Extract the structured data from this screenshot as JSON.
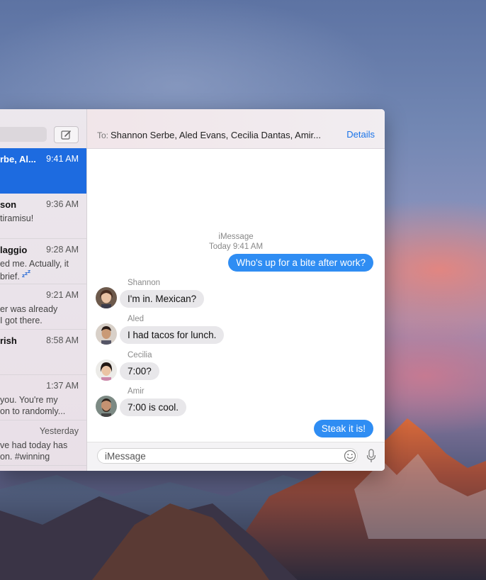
{
  "sidebar": {
    "conversations": [
      {
        "name": "rbe, Al...",
        "time": "9:41 AM",
        "preview": [],
        "active": true
      },
      {
        "name": "son",
        "time": "9:36 AM",
        "preview": [
          "tiramisu!"
        ]
      },
      {
        "name": "laggio",
        "time": "9:28 AM",
        "preview": [
          "ed me. Actually, it",
          "brief."
        ]
      },
      {
        "name": "",
        "time": "9:21 AM",
        "preview": [
          "er was already",
          "I got there."
        ]
      },
      {
        "name": "rish",
        "time": "8:58 AM",
        "preview": []
      },
      {
        "name": "",
        "time": "1:37 AM",
        "preview": [
          "you. You're my",
          "on to randomly..."
        ]
      },
      {
        "name": "",
        "time": "Yesterday",
        "preview": [
          "ve had today has",
          "on. #winning"
        ]
      }
    ]
  },
  "header": {
    "to_label": "To:",
    "recipients": "Shannon Serbe, Aled Evans, Cecilia Dantas, Amir...",
    "details_label": "Details"
  },
  "thread": {
    "service": "iMessage",
    "timestamp": "Today 9:41 AM",
    "messages": [
      {
        "from": "me",
        "text": "Who's up for a bite after work?"
      },
      {
        "from": "Shannon",
        "text": "I'm in. Mexican?"
      },
      {
        "from": "Aled",
        "text": "I had tacos for lunch."
      },
      {
        "from": "Cecilia",
        "text": "7:00?"
      },
      {
        "from": "Amir",
        "text": "7:00 is cool."
      },
      {
        "from": "me",
        "text": "Steak it is!"
      }
    ]
  },
  "composer": {
    "placeholder": "iMessage"
  },
  "colors": {
    "accent": "#1d6be0",
    "outgoing_bubble": "#2f8df3",
    "incoming_bubble": "#e8e7ea",
    "link": "#1a73e8"
  }
}
